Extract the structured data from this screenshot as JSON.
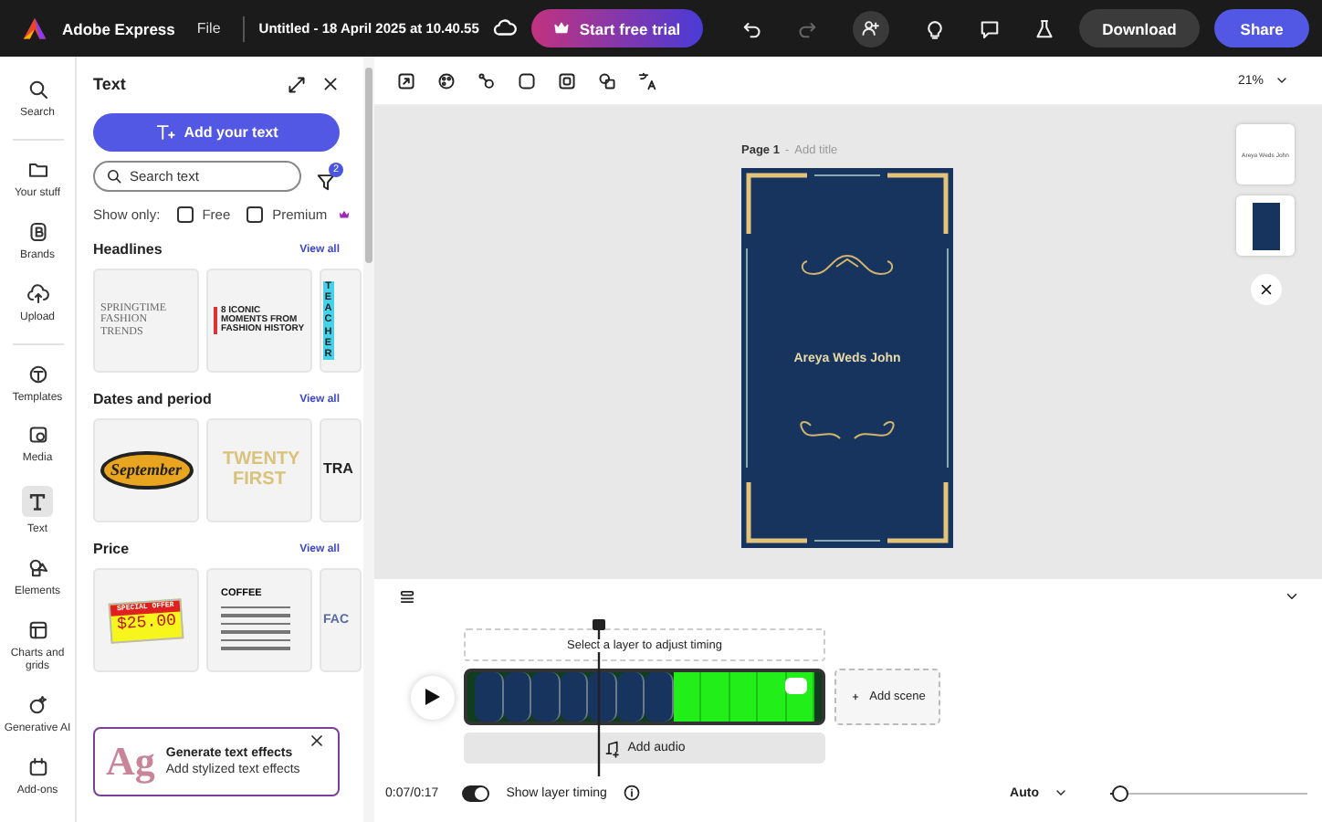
{
  "app": {
    "name": "Adobe Express",
    "menu": "File",
    "document_title": "Untitled - 18 April 2025 at 10.40.55",
    "trial_button": "Start free trial",
    "history": [
      {
        "kind": "undo",
        "disabled": false
      },
      {
        "kind": "redo",
        "disabled": true
      }
    ],
    "download": "Download",
    "share": "Share"
  },
  "rail": [
    {
      "label": "Search",
      "kind": "search",
      "selected": false
    },
    {
      "label": "Your stuff",
      "kind": "folder",
      "selected": false
    },
    {
      "label": "Brands",
      "kind": "brand",
      "selected": false
    },
    {
      "label": "Upload",
      "kind": "upload",
      "selected": false
    },
    {
      "label": "Templates",
      "kind": "templates",
      "selected": false
    },
    {
      "label": "Media",
      "kind": "media",
      "selected": false
    },
    {
      "label": "Text",
      "kind": "text",
      "selected": true
    },
    {
      "label": "Elements",
      "kind": "elements",
      "selected": false
    },
    {
      "label": "Charts and grids",
      "kind": "charts",
      "selected": false
    },
    {
      "label": "Generative AI",
      "kind": "ai",
      "selected": false
    },
    {
      "label": "Add-ons",
      "kind": "addons",
      "selected": false
    }
  ],
  "panel": {
    "title": "Text",
    "add_button": "Add your text",
    "search": {
      "placeholder": "Search text"
    },
    "filter_count": "2",
    "show_only": "Show only:",
    "filters": [
      {
        "label": "Free",
        "kind": "plain",
        "checked": false
      },
      {
        "label": "Premium",
        "kind": "premium",
        "checked": false
      }
    ],
    "sections": [
      {
        "title": "Headlines",
        "view_all": "View all",
        "previews": [
          {
            "kind": "serif",
            "text": "SPRINGTIME FASHION TRENDS"
          },
          {
            "kind": "banner",
            "text": "8 ICONIC MOMENTS FROM FASHION HISTORY"
          },
          {
            "kind": "vertical",
            "text": "TEACHER"
          }
        ]
      },
      {
        "title": "Dates and period",
        "view_all": "View all",
        "previews": [
          {
            "kind": "script",
            "text": "September"
          },
          {
            "kind": "gold",
            "text": "TWENTY FIRST"
          },
          {
            "kind": "bold",
            "text": "TRA"
          }
        ]
      },
      {
        "title": "Price",
        "view_all": "View all",
        "previews": [
          {
            "kind": "price",
            "tag": "SPECIAL OFFER",
            "text": "$25.00"
          },
          {
            "kind": "menu",
            "text": "COFFEE"
          },
          {
            "kind": "outline",
            "text": "FAC"
          }
        ]
      }
    ],
    "promo": {
      "art": "Ag",
      "title": "Generate text effects",
      "subtitle": "Add stylized text effects"
    }
  },
  "toolbar": {
    "zoom": "21%"
  },
  "page": {
    "label": "Page 1",
    "separator": "-",
    "title_placeholder": "Add title",
    "text": "Areya Weds John"
  },
  "page_thumbnails": [
    {
      "kind": "text",
      "text": "Areya Weds John"
    },
    {
      "kind": "page"
    }
  ],
  "timeline": {
    "hint": "Select a layer to adjust timing",
    "add_scene": "Add scene",
    "add_audio": "Add audio",
    "time": "0:07/0:17",
    "layer_timing": {
      "label": "Show layer timing",
      "on": true
    },
    "zoom_mode": "Auto",
    "zoom": {
      "level": 0.05
    }
  }
}
